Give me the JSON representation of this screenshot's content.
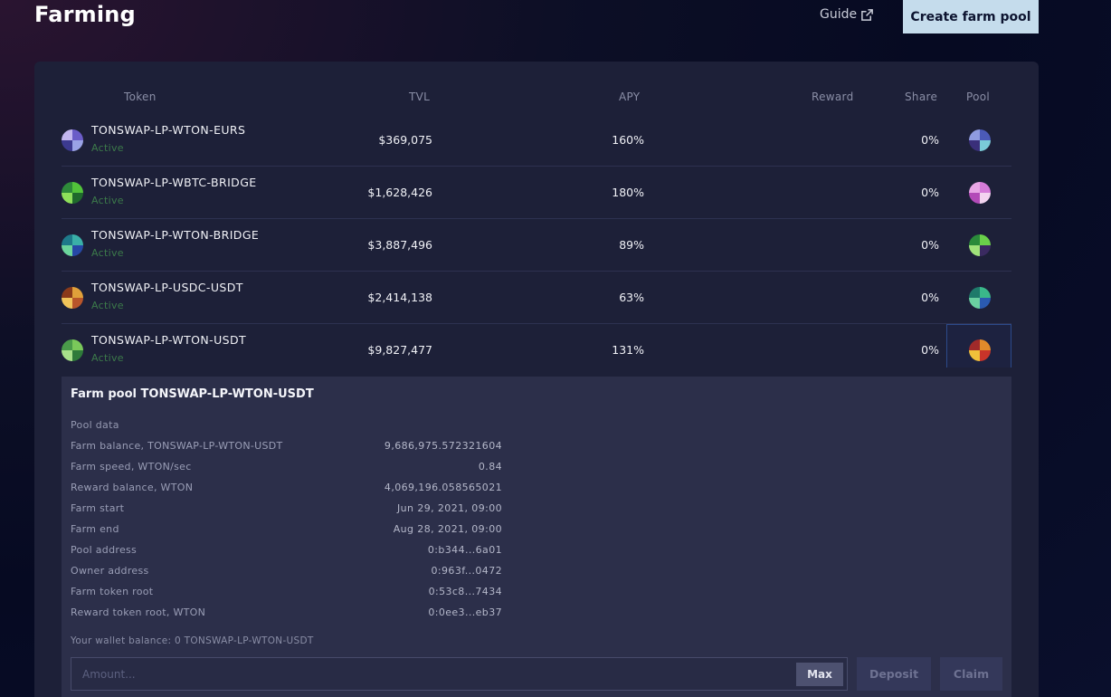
{
  "header": {
    "title": "Farming",
    "guide_label": "Guide",
    "create_label": "Create farm pool"
  },
  "table": {
    "columns": [
      "Token",
      "TVL",
      "APY",
      "Reward",
      "Share",
      "Pool"
    ],
    "rows": [
      {
        "name": "TONSWAP-LP-WTON-EURS",
        "status": "Active",
        "tvl": "$369,075",
        "apy": "160%",
        "share": "0%"
      },
      {
        "name": "TONSWAP-LP-WBTC-BRIDGE",
        "status": "Active",
        "tvl": "$1,628,426",
        "apy": "180%",
        "share": "0%"
      },
      {
        "name": "TONSWAP-LP-WTON-BRIDGE",
        "status": "Active",
        "tvl": "$3,887,496",
        "apy": "89%",
        "share": "0%"
      },
      {
        "name": "TONSWAP-LP-USDC-USDT",
        "status": "Active",
        "tvl": "$2,414,138",
        "apy": "63%",
        "share": "0%"
      },
      {
        "name": "TONSWAP-LP-WTON-USDT",
        "status": "Active",
        "tvl": "$9,827,477",
        "apy": "131%",
        "share": "0%"
      }
    ]
  },
  "detail": {
    "title": "Farm pool TONSWAP-LP-WTON-USDT",
    "section": "Pool data",
    "items": [
      {
        "label": "Farm balance, TONSWAP-LP-WTON-USDT",
        "value": "9,686,975.572321604"
      },
      {
        "label": "Farm speed, WTON/sec",
        "value": "0.84"
      },
      {
        "label": "Reward balance, WTON",
        "value": "4,069,196.058565021"
      },
      {
        "label": "Farm start",
        "value": "Jun 29, 2021, 09:00"
      },
      {
        "label": "Farm end",
        "value": "Aug 28, 2021, 09:00"
      },
      {
        "label": "Pool address",
        "value": "0:b344...6a01"
      },
      {
        "label": "Owner address",
        "value": "0:963f...0472"
      },
      {
        "label": "Farm token root",
        "value": "0:53c8...7434"
      },
      {
        "label": "Reward token root, WTON",
        "value": "0:0ee3...eb37"
      }
    ],
    "wallet_balance": "Your wallet balance: 0 TONSWAP-LP-WTON-USDT",
    "amount_placeholder": "Amount...",
    "max_label": "Max",
    "deposit_label": "Deposit",
    "claim_label": "Claim"
  },
  "icons": {
    "guide": "external-link-icon",
    "token": "token-avatar-icon",
    "pool": "pool-avatar-icon"
  }
}
